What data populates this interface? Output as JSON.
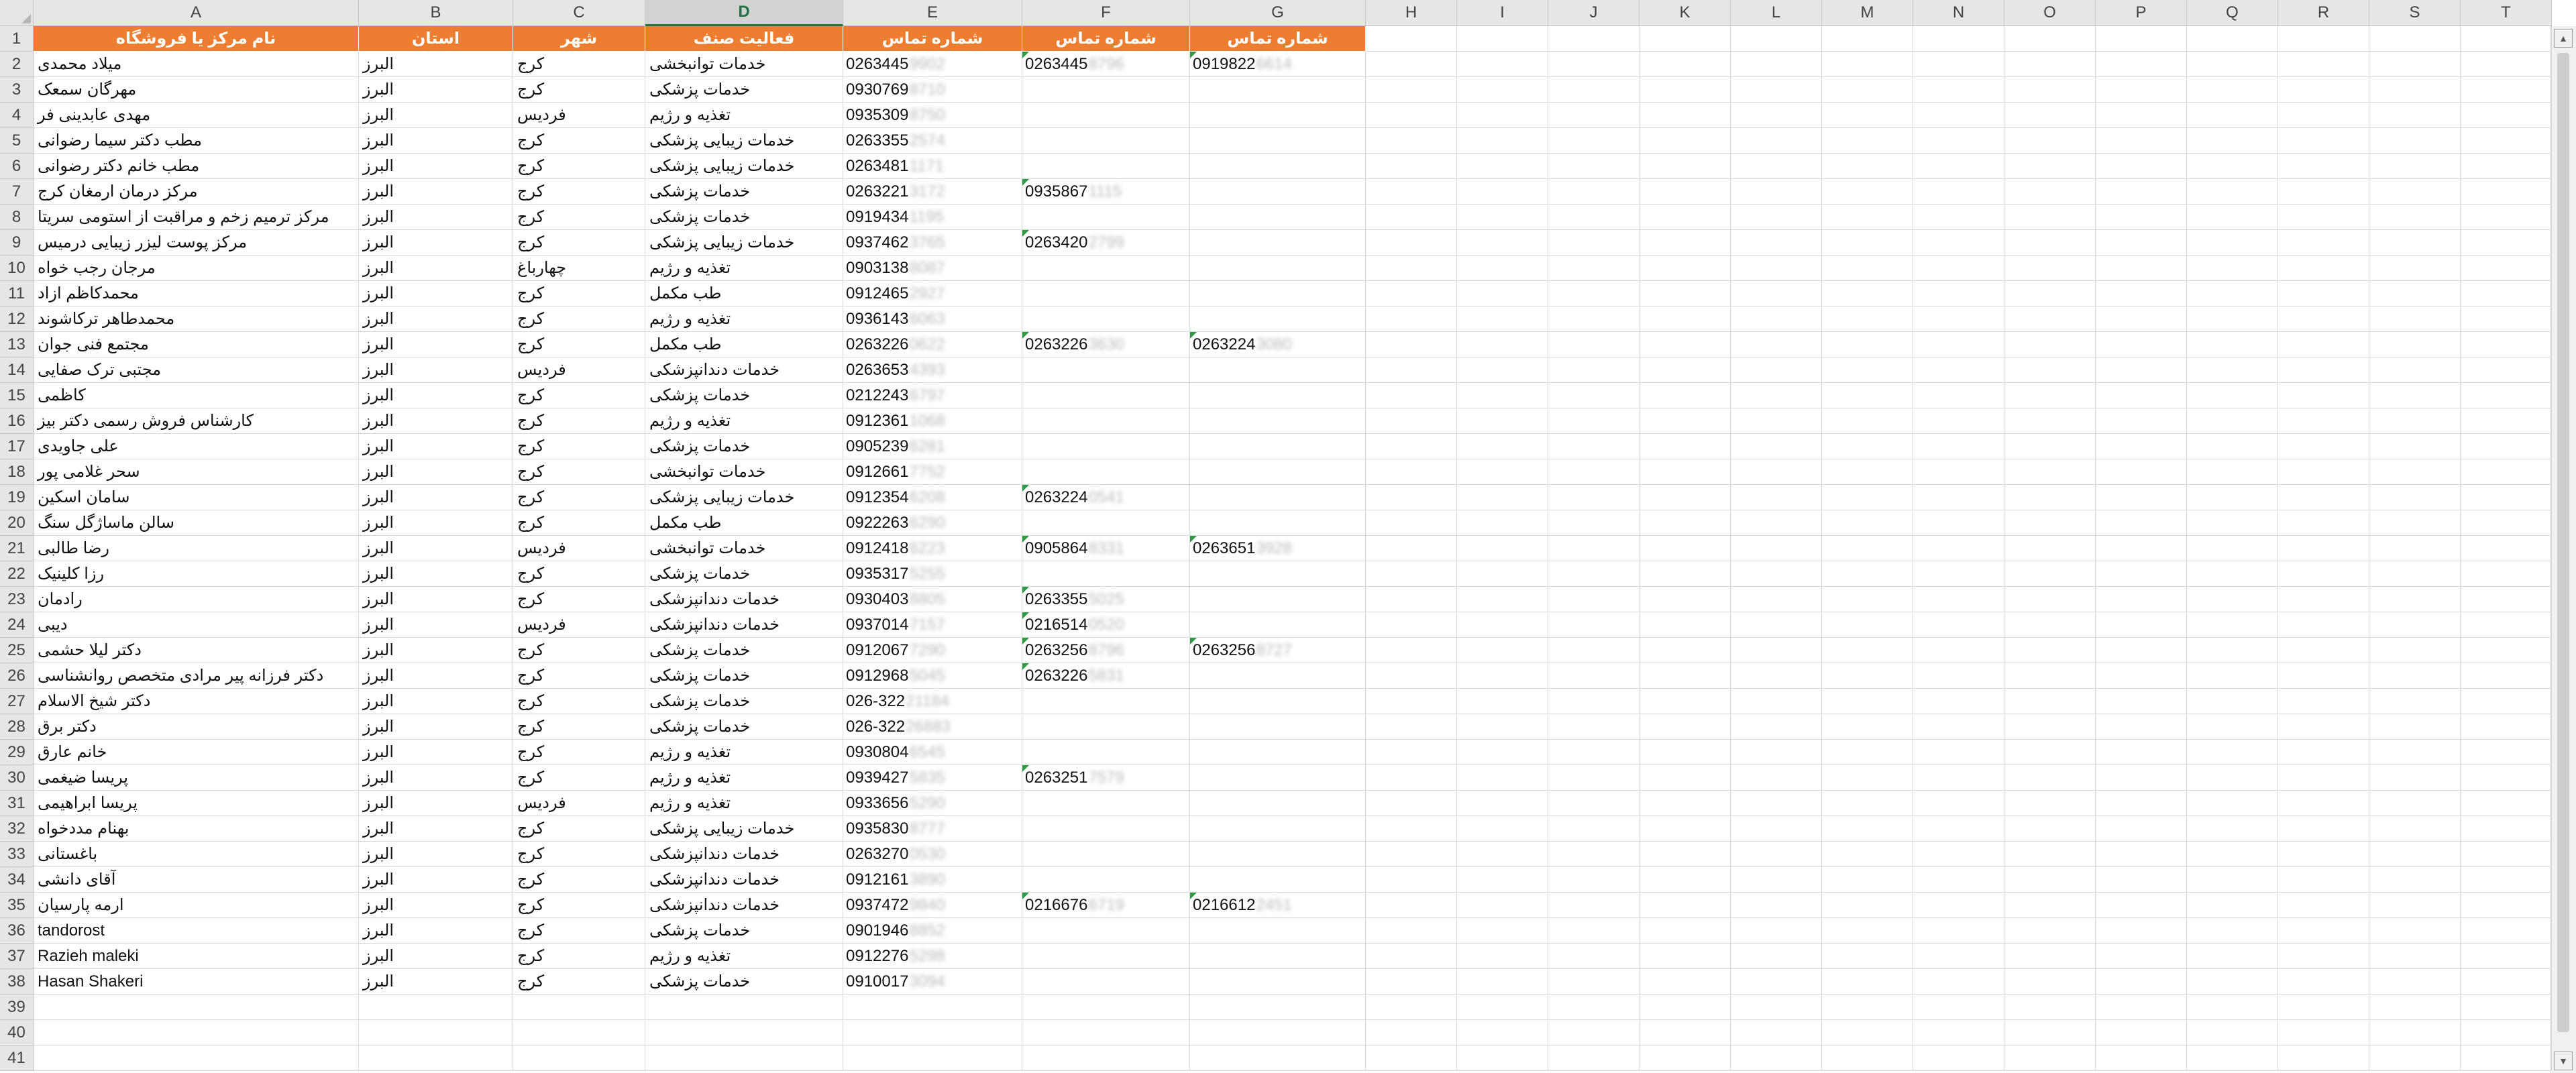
{
  "columns": [
    "A",
    "B",
    "C",
    "D",
    "E",
    "F",
    "G",
    "H",
    "I",
    "J",
    "K",
    "L",
    "M",
    "N",
    "O",
    "P",
    "Q",
    "R",
    "S",
    "T"
  ],
  "active_column": "D",
  "header_row": {
    "A": "نام مرکز یا فروشگاه",
    "B": "استان",
    "C": "شهر",
    "D": "فعالیت صنف",
    "E": "شماره تماس",
    "F": "شماره تماس",
    "G": "شماره تماس"
  },
  "rows": [
    {
      "A": "میلاد محمدی",
      "B": "البرز",
      "C": "کرج",
      "D": "خدمات توانبخشی",
      "E": {
        "p": "0263445",
        "h": "9902"
      },
      "F": {
        "p": "0263445",
        "h": "8796"
      },
      "G": {
        "p": "0919822",
        "h": "6614"
      }
    },
    {
      "A": "مهرگان سمعک",
      "B": "البرز",
      "C": "کرج",
      "D": "خدمات پزشکی",
      "E": {
        "p": "0930769",
        "h": "8710"
      }
    },
    {
      "A": "مهدی عابدینی فر",
      "B": "البرز",
      "C": "فردیس",
      "D": "تغذیه و رژیم",
      "E": {
        "p": "0935309",
        "h": "8750"
      }
    },
    {
      "A": "مطب دکتر سیما رضوانی",
      "B": "البرز",
      "C": "کرج",
      "D": "خدمات زیبایی پزشکی",
      "E": {
        "p": "0263355",
        "h": "2574"
      }
    },
    {
      "A": "مطب خانم دکتر رضوانی",
      "B": "البرز",
      "C": "کرج",
      "D": "خدمات زیبایی پزشکی",
      "E": {
        "p": "0263481",
        "h": "1171"
      }
    },
    {
      "A": "مرکز درمان ارمغان کرج",
      "B": "البرز",
      "C": "کرج",
      "D": "خدمات پزشکی",
      "E": {
        "p": "0263221",
        "h": "3172"
      },
      "F": {
        "p": "0935867",
        "h": "1115"
      }
    },
    {
      "A": "مرکز ترمیم زخم و مراقبت از استومی سریتا",
      "B": "البرز",
      "C": "کرج",
      "D": "خدمات پزشکی",
      "E": {
        "p": "0919434",
        "h": "1195"
      }
    },
    {
      "A": "مرکز پوست لیزر زیبایی درمیس",
      "B": "البرز",
      "C": "کرج",
      "D": "خدمات زیبایی پزشکی",
      "E": {
        "p": "0937462",
        "h": "3765"
      },
      "F": {
        "p": "0263420",
        "h": "2799"
      }
    },
    {
      "A": "مرجان رجب خواه",
      "B": "البرز",
      "C": "چهارباغ",
      "D": "تغذیه و رژیم",
      "E": {
        "p": "0903138",
        "h": "8087"
      }
    },
    {
      "A": "محمدکاظم ازاد",
      "B": "البرز",
      "C": "کرج",
      "D": "طب مکمل",
      "E": {
        "p": "0912465",
        "h": "2927"
      }
    },
    {
      "A": "محمدطاهر ترکاشوند",
      "B": "البرز",
      "C": "کرج",
      "D": "تغذیه و رژیم",
      "E": {
        "p": "0936143",
        "h": "6063"
      }
    },
    {
      "A": "مجتمع فنی جوان",
      "B": "البرز",
      "C": "کرج",
      "D": "طب مکمل",
      "E": {
        "p": "0263226",
        "h": "0622"
      },
      "F": {
        "p": "0263226",
        "h": "3630"
      },
      "G": {
        "p": "0263224",
        "h": "3080"
      }
    },
    {
      "A": "مجتبی ترک صفایی",
      "B": "البرز",
      "C": "فردیس",
      "D": "خدمات دندانپزشکی",
      "E": {
        "p": "0263653",
        "h": "4393"
      }
    },
    {
      "A": "کاظمی",
      "B": "البرز",
      "C": "کرج",
      "D": "خدمات پزشکی",
      "E": {
        "p": "0212243",
        "h": "6797"
      }
    },
    {
      "A": "کارشناس فروش رسمی دکتر بیز",
      "B": "البرز",
      "C": "کرج",
      "D": "تغذیه و رژیم",
      "E": {
        "p": "0912361",
        "h": "1068"
      }
    },
    {
      "A": "علی جاویدی",
      "B": "البرز",
      "C": "کرج",
      "D": "خدمات پزشکی",
      "E": {
        "p": "0905239",
        "h": "6281"
      }
    },
    {
      "A": "سحر غلامی پور",
      "B": "البرز",
      "C": "کرج",
      "D": "خدمات توانبخشی",
      "E": {
        "p": "0912661",
        "h": "7752"
      }
    },
    {
      "A": "سامان اسکین",
      "B": "البرز",
      "C": "کرج",
      "D": "خدمات زیبایی پزشکی",
      "E": {
        "p": "0912354",
        "h": "6208"
      },
      "F": {
        "p": "0263224",
        "h": "0541"
      }
    },
    {
      "A": "سالن ماساژگل سنگ",
      "B": "البرز",
      "C": "کرج",
      "D": "طب مکمل",
      "E": {
        "p": "0922263",
        "h": "6290"
      }
    },
    {
      "A": "رضا طالبی",
      "B": "البرز",
      "C": "فردیس",
      "D": "خدمات توانبخشی",
      "E": {
        "p": "0912418",
        "h": "6223"
      },
      "F": {
        "p": "0905864",
        "h": "8331"
      },
      "G": {
        "p": "0263651",
        "h": "3928"
      }
    },
    {
      "A": "رزا کلینیک",
      "B": "البرز",
      "C": "کرج",
      "D": "خدمات پزشکی",
      "E": {
        "p": "0935317",
        "h": "5255"
      }
    },
    {
      "A": "رادمان",
      "B": "البرز",
      "C": "کرج",
      "D": "خدمات دندانپزشکی",
      "E": {
        "p": "0930403",
        "h": "8805"
      },
      "F": {
        "p": "0263355",
        "h": "5025"
      }
    },
    {
      "A": "دیبی",
      "B": "البرز",
      "C": "فردیس",
      "D": "خدمات دندانپزشکی",
      "E": {
        "p": "0937014",
        "h": "7157"
      },
      "F": {
        "p": "0216514",
        "h": "0520"
      }
    },
    {
      "A": "دکتر لیلا حشمی",
      "B": "البرز",
      "C": "کرج",
      "D": "خدمات پزشکی",
      "E": {
        "p": "0912067",
        "h": "7290"
      },
      "F": {
        "p": "0263256",
        "h": "8796"
      },
      "G": {
        "p": "0263256",
        "h": "8727"
      }
    },
    {
      "A": "دکتر فرزانه پیر مرادی متخصص روانشناسی",
      "B": "البرز",
      "C": "کرج",
      "D": "خدمات پزشکی",
      "E": {
        "p": "0912968",
        "h": "5045"
      },
      "F": {
        "p": "0263226",
        "h": "5831"
      }
    },
    {
      "A": "دکتر شیخ الاسلام",
      "B": "البرز",
      "C": "کرج",
      "D": "خدمات پزشکی",
      "E": {
        "p": "026-322",
        "h": "21184"
      }
    },
    {
      "A": "دکتر برق",
      "B": "البرز",
      "C": "کرج",
      "D": "خدمات پزشکی",
      "E": {
        "p": "026-322",
        "h": "26883"
      }
    },
    {
      "A": "خانم عارق",
      "B": "البرز",
      "C": "کرج",
      "D": "تغذیه و رژیم",
      "E": {
        "p": "0930804",
        "h": "6545"
      }
    },
    {
      "A": "پریسا ضیغمی",
      "B": "البرز",
      "C": "کرج",
      "D": "تغذیه و رژیم",
      "E": {
        "p": "0939427",
        "h": "5835"
      },
      "F": {
        "p": "0263251",
        "h": "7579"
      }
    },
    {
      "A": "پریسا ابراهیمی",
      "B": "البرز",
      "C": "فردیس",
      "D": "تغذیه و رژیم",
      "E": {
        "p": "0933656",
        "h": "5290"
      }
    },
    {
      "A": "بهنام مددخواه",
      "B": "البرز",
      "C": "کرج",
      "D": "خدمات زیبایی پزشکی",
      "E": {
        "p": "0935830",
        "h": "8777"
      }
    },
    {
      "A": "باغستانی",
      "B": "البرز",
      "C": "کرج",
      "D": "خدمات دندانپزشکی",
      "E": {
        "p": "0263270",
        "h": "0530"
      }
    },
    {
      "A": "آقای دانشی",
      "B": "البرز",
      "C": "کرج",
      "D": "خدمات دندانپزشکی",
      "E": {
        "p": "0912161",
        "h": "3890"
      }
    },
    {
      "A": "ارمه پارسیان",
      "B": "البرز",
      "C": "کرج",
      "D": "خدمات دندانپزشکی",
      "E": {
        "p": "0937472",
        "h": "9840"
      },
      "F": {
        "p": "0216676",
        "h": "6719"
      },
      "G": {
        "p": "0216612",
        "h": "2451"
      }
    },
    {
      "A": "tandorost",
      "B": "البرز",
      "C": "کرج",
      "D": "خدمات پزشکی",
      "E": {
        "p": "0901946",
        "h": "8852"
      }
    },
    {
      "A": "Razieh maleki",
      "B": "البرز",
      "C": "کرج",
      "D": "تغذیه و رژیم",
      "E": {
        "p": "0912276",
        "h": "5298"
      }
    },
    {
      "A": "Hasan Shakeri",
      "B": "البرز",
      "C": "کرج",
      "D": "خدمات پزشکی",
      "E": {
        "p": "0910017",
        "h": "3094"
      }
    },
    {},
    {},
    {}
  ],
  "colors": {
    "header_fill": "#ed7d31",
    "header_text": "#ffffff",
    "comment_marker": "#2f9a45",
    "active_column_accent": "#217346"
  },
  "icons": {
    "corner": "select-all-triangle-icon",
    "scroll_up": "chevron-up-icon",
    "scroll_down": "chevron-down-icon"
  }
}
